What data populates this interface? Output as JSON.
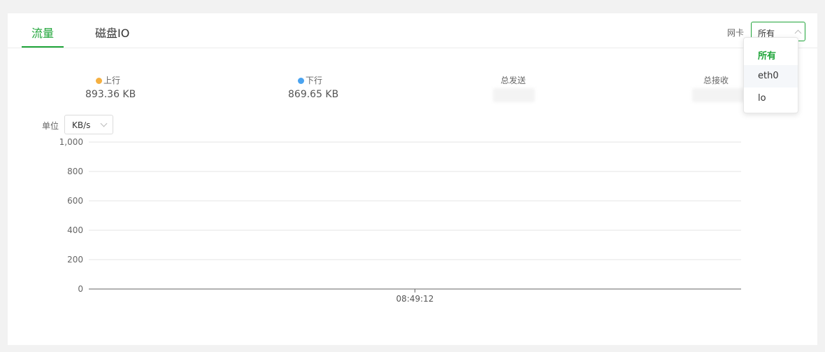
{
  "tabs": [
    {
      "label": "流量",
      "active": true
    },
    {
      "label": "磁盘IO",
      "active": false
    }
  ],
  "nic": {
    "label": "网卡",
    "selected": "所有",
    "options": [
      "所有",
      "eth0",
      "lo"
    ]
  },
  "stats": {
    "upstream": {
      "label": "上行",
      "value": "893.36 KB",
      "color": "#f5b041"
    },
    "downstream": {
      "label": "下行",
      "value": "869.65 KB",
      "color": "#4aa3f0"
    },
    "total_sent": {
      "label": "总发送"
    },
    "total_received": {
      "label": "总接收"
    }
  },
  "unit": {
    "label": "单位",
    "value": "KB/s"
  },
  "chart_data": {
    "type": "line",
    "ylim": [
      0,
      1000
    ],
    "yticks": [
      "1,000",
      "800",
      "600",
      "400",
      "200",
      "0"
    ],
    "ytick_values": [
      1000,
      800,
      600,
      400,
      200,
      0
    ],
    "categories": [
      "08:49:12"
    ],
    "series": [],
    "grid": true
  },
  "colors": {
    "accent": "#20a53a"
  }
}
